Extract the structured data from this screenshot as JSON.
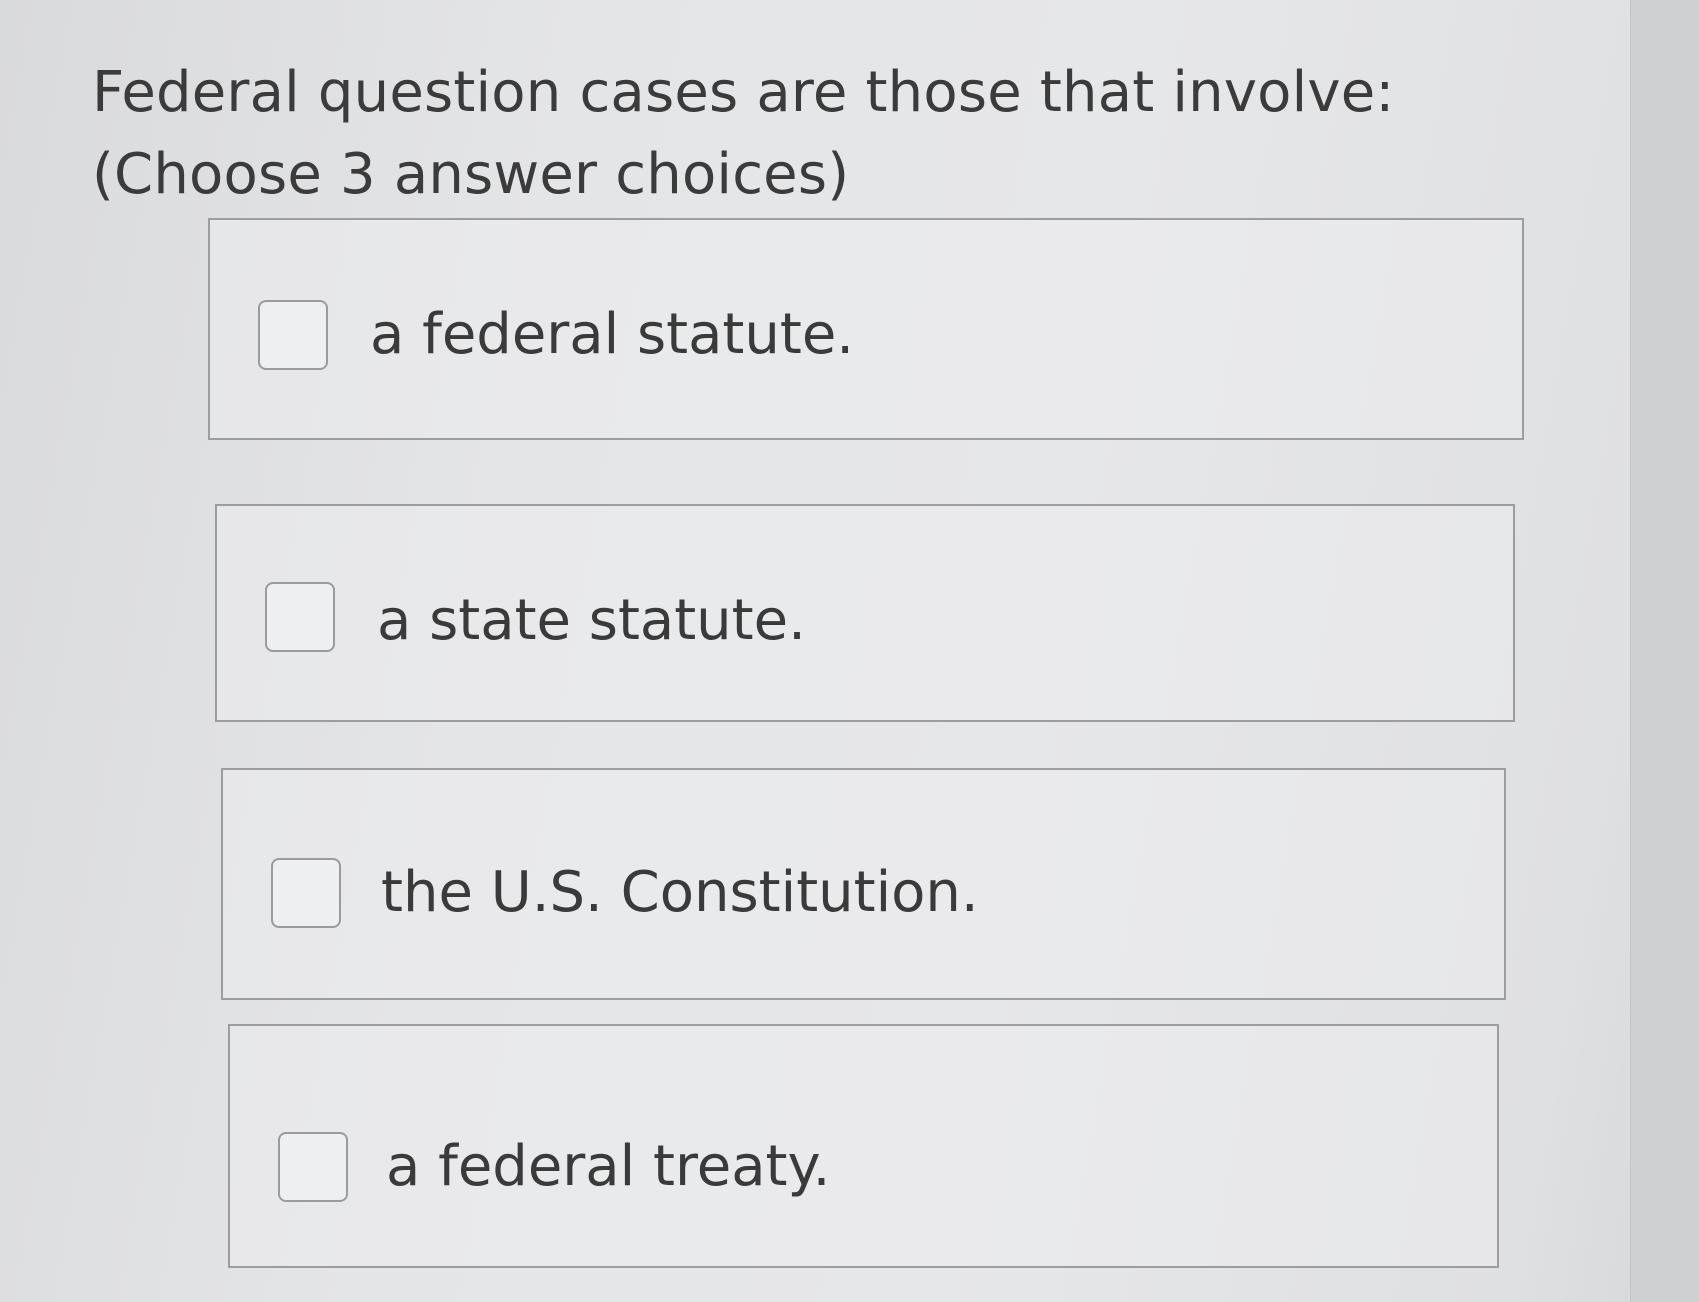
{
  "question": {
    "text": "Federal question cases are those that involve: (Choose 3 answer choices)"
  },
  "choices": [
    {
      "label": "a federal statute.",
      "checked": false,
      "checkbox_icon": "empty-checkbox-icon"
    },
    {
      "label": "a state statute.",
      "checked": false,
      "checkbox_icon": "empty-checkbox-icon"
    },
    {
      "label": "the U.S. Constitution.",
      "checked": false,
      "checkbox_icon": "empty-checkbox-icon"
    },
    {
      "label": "a federal treaty.",
      "checked": false,
      "checkbox_icon": "empty-checkbox-icon"
    }
  ],
  "colors": {
    "text": "#3a3a3a",
    "border": "#9c9d9f",
    "background": "#e4e5e7"
  }
}
